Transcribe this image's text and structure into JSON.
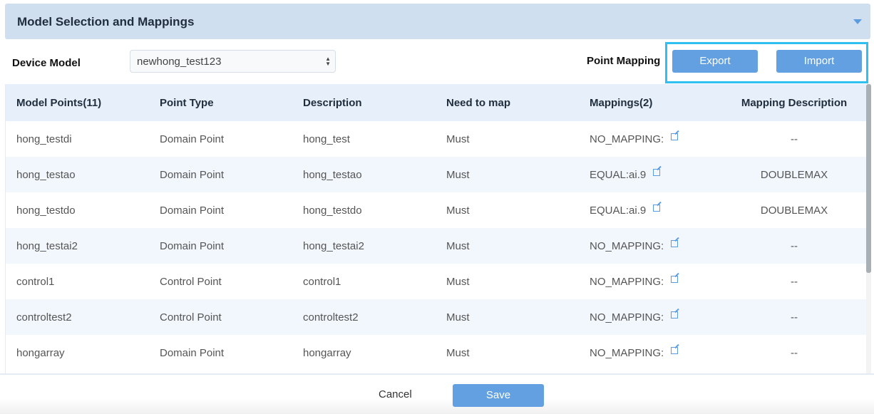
{
  "panel": {
    "title": "Model Selection and Mappings"
  },
  "device_model": {
    "label": "Device Model",
    "value": "newhong_test123"
  },
  "point_mapping": {
    "label": "Point Mapping",
    "export": "Export",
    "import": "Import"
  },
  "table": {
    "headers": [
      "Model Points(11)",
      "Point Type",
      "Description",
      "Need to map",
      "Mappings(2)",
      "Mapping Description"
    ],
    "rows": [
      [
        "hong_testdi",
        "Domain Point",
        "hong_test",
        "Must",
        "NO_MAPPING:",
        "--"
      ],
      [
        "hong_testao",
        "Domain Point",
        "hong_testao",
        "Must",
        "EQUAL:ai.9",
        "DOUBLEMAX"
      ],
      [
        "hong_testdo",
        "Domain Point",
        "hong_testdo",
        "Must",
        "EQUAL:ai.9",
        "DOUBLEMAX"
      ],
      [
        "hong_testai2",
        "Domain Point",
        "hong_testai2",
        "Must",
        "NO_MAPPING:",
        "--"
      ],
      [
        "control1",
        "Control Point",
        "control1",
        "Must",
        "NO_MAPPING:",
        "--"
      ],
      [
        "controltest2",
        "Control Point",
        "controltest2",
        "Must",
        "NO_MAPPING:",
        "--"
      ],
      [
        "hongarray",
        "Domain Point",
        "hongarray",
        "Must",
        "NO_MAPPING:",
        "--"
      ]
    ]
  },
  "footer": {
    "cancel": "Cancel",
    "save": "Save"
  }
}
